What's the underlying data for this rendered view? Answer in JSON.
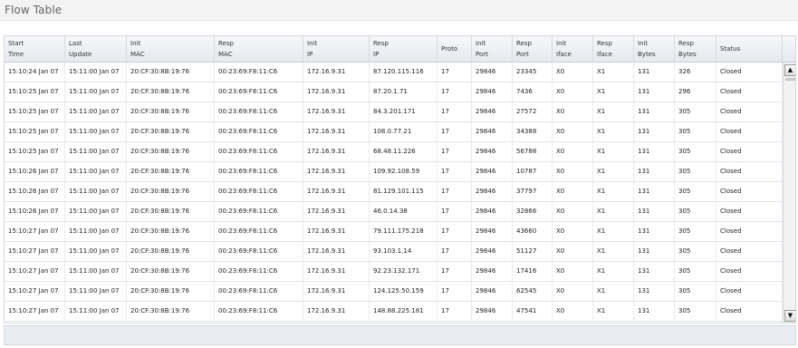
{
  "page": {
    "title": "Flow Table"
  },
  "columns": [
    {
      "key": "start",
      "line1": "Start",
      "line2": "Time"
    },
    {
      "key": "last",
      "line1": "Last",
      "line2": "Update"
    },
    {
      "key": "imac",
      "line1": "Init",
      "line2": "MAC"
    },
    {
      "key": "rmac",
      "line1": "Resp",
      "line2": "MAC"
    },
    {
      "key": "iip",
      "line1": "Init",
      "line2": "IP"
    },
    {
      "key": "rip",
      "line1": "Resp",
      "line2": "IP"
    },
    {
      "key": "proto",
      "line1": "Proto",
      "line2": ""
    },
    {
      "key": "iport",
      "line1": "Init",
      "line2": "Port"
    },
    {
      "key": "rport",
      "line1": "Resp",
      "line2": "Port"
    },
    {
      "key": "iiface",
      "line1": "Init",
      "line2": "Iface"
    },
    {
      "key": "riface",
      "line1": "Resp",
      "line2": "Iface"
    },
    {
      "key": "ibytes",
      "line1": "Init",
      "line2": "Bytes"
    },
    {
      "key": "rbytes",
      "line1": "Resp",
      "line2": "Bytes"
    },
    {
      "key": "status",
      "line1": "Status",
      "line2": ""
    }
  ],
  "rows": [
    [
      "15:10:24 Jan 07",
      "15:11:00 Jan 07",
      "20:CF:30:8B:19:76",
      "00:23:69:F8:11:C6",
      "172.16.9.31",
      "87.120.115.116",
      "17",
      "29846",
      "23345",
      "X0",
      "X1",
      "131",
      "326",
      "Closed"
    ],
    [
      "15:10:25 Jan 07",
      "15:11:00 Jan 07",
      "20:CF:30:8B:19:76",
      "00:23:69:F8:11:C6",
      "172.16.9.31",
      "87.20.1.71",
      "17",
      "29846",
      "7436",
      "X0",
      "X1",
      "131",
      "296",
      "Closed"
    ],
    [
      "15:10:25 Jan 07",
      "15:11:00 Jan 07",
      "20:CF:30:8B:19:76",
      "00:23:69:F8:11:C6",
      "172.16.9.31",
      "84.3.201.171",
      "17",
      "29846",
      "27572",
      "X0",
      "X1",
      "131",
      "305",
      "Closed"
    ],
    [
      "15:10:25 Jan 07",
      "15:11:00 Jan 07",
      "20:CF:30:8B:19:76",
      "00:23:69:F8:11:C6",
      "172.16.9.31",
      "108.0.77.21",
      "17",
      "29846",
      "34388",
      "X0",
      "X1",
      "131",
      "305",
      "Closed"
    ],
    [
      "15:10:25 Jan 07",
      "15:11:00 Jan 07",
      "20:CF:30:8B:19:76",
      "00:23:69:F8:11:C6",
      "172.16.9.31",
      "68.48.11.226",
      "17",
      "29846",
      "56788",
      "X0",
      "X1",
      "131",
      "305",
      "Closed"
    ],
    [
      "15:10:26 Jan 07",
      "15:11:00 Jan 07",
      "20:CF:30:8B:19:76",
      "00:23:69:F8:11:C6",
      "172.16.9.31",
      "109.92.108.59",
      "17",
      "29846",
      "10787",
      "X0",
      "X1",
      "131",
      "305",
      "Closed"
    ],
    [
      "15:10:26 Jan 07",
      "15:11:00 Jan 07",
      "20:CF:30:8B:19:76",
      "00:23:69:F8:11:C6",
      "172.16.9.31",
      "81.129.101.115",
      "17",
      "29846",
      "37797",
      "X0",
      "X1",
      "131",
      "305",
      "Closed"
    ],
    [
      "15:10:26 Jan 07",
      "15:11:00 Jan 07",
      "20:CF:30:8B:19:76",
      "00:23:69:F8:11:C6",
      "172.16.9.31",
      "46.0.14.38",
      "17",
      "29846",
      "32866",
      "X0",
      "X1",
      "131",
      "305",
      "Closed"
    ],
    [
      "15:10:27 Jan 07",
      "15:11:00 Jan 07",
      "20:CF:30:8B:19:76",
      "00:23:69:F8:11:C6",
      "172.16.9.31",
      "79.111.175.218",
      "17",
      "29846",
      "43660",
      "X0",
      "X1",
      "131",
      "305",
      "Closed"
    ],
    [
      "15:10:27 Jan 07",
      "15:11:00 Jan 07",
      "20:CF:30:8B:19:76",
      "00:23:69:F8:11:C6",
      "172.16.9.31",
      "93.103.1.14",
      "17",
      "29846",
      "51127",
      "X0",
      "X1",
      "131",
      "305",
      "Closed"
    ],
    [
      "15:10:27 Jan 07",
      "15:11:00 Jan 07",
      "20:CF:30:8B:19:76",
      "00:23:69:F8:11:C6",
      "172.16.9.31",
      "92.23.132.171",
      "17",
      "29846",
      "17416",
      "X0",
      "X1",
      "131",
      "305",
      "Closed"
    ],
    [
      "15:10:27 Jan 07",
      "15:11:00 Jan 07",
      "20:CF:30:8B:19:76",
      "00:23:69:F8:11:C6",
      "172.16.9.31",
      "124.125.50.159",
      "17",
      "29846",
      "62545",
      "X0",
      "X1",
      "131",
      "305",
      "Closed"
    ],
    [
      "15:10:27 Jan 07",
      "15:11:00 Jan 07",
      "20:CF:30:8B:19:76",
      "00:23:69:F8:11:C6",
      "172.16.9.31",
      "148.88.225.181",
      "17",
      "29846",
      "47541",
      "X0",
      "X1",
      "131",
      "305",
      "Closed"
    ]
  ],
  "scrollbar": {
    "up_icon": "scroll-up-icon",
    "down_icon": "scroll-down-icon"
  }
}
